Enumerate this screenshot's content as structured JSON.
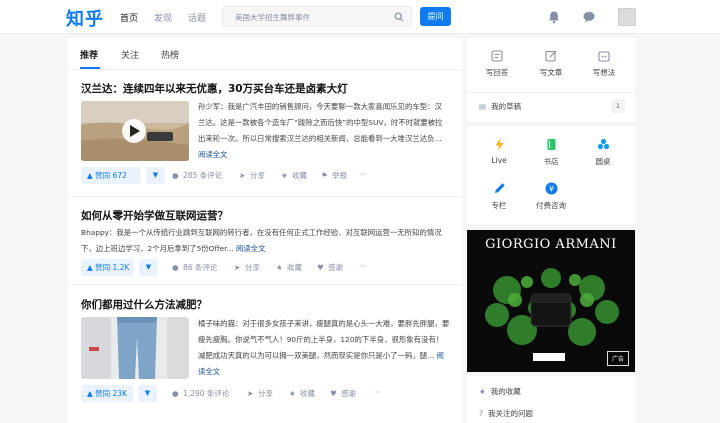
{
  "header": {
    "logo": "知乎",
    "nav": [
      "首页",
      "发现",
      "话题"
    ],
    "search_placeholder": "美国大学招生舞弊事件",
    "ask_button": "提问"
  },
  "feed": {
    "tabs": [
      "推荐",
      "关注",
      "热榜"
    ],
    "cards": [
      {
        "title": "汉兰达：连续四年以来无优惠，30万买台车还是卤素大灯",
        "excerpt": "孙少军：我是广汽丰田的销售顾问，今天要聊一款大家喜闻乐见的车型：汉兰达。这是一款被各个造车厂“跋除之而后快”的中型SUV，时不时就要被拉出来轮一次。所以日常搜索汉兰达的相关新闻，总能看到一大堆汉兰达负...",
        "read_more": "阅读全文",
        "vote": "赞同 672",
        "comments": "285 条评论",
        "share": "分享",
        "favorite": "收藏",
        "extra": "举报",
        "more": "···"
      },
      {
        "title": "如何从零开始学做互联网运营？",
        "excerpt": "Bhappy：我是一个从传统行业跳到互联网的转行者，在没有任何正式工作经验、对互联网运营一无所知的情况下，边上班边学习，2个月后拿到了5份Offer...",
        "read_more": "阅读全文",
        "vote": "赞同 1.2K",
        "comments": "86 条评论",
        "share": "分享",
        "favorite": "收藏",
        "extra": "感谢",
        "more": "···"
      },
      {
        "title": "你们都用过什么方法减肥？",
        "excerpt": "橘子味的猫：对于很多女孩子来讲，瘦腿真的是心头一大难，要胖先胖腿，要瘦先瘦胸。你说气不气人！90斤的上半身，120的下半身，很形象有没有！减肥成功天真的以为可以拥一双美腿，然而现实是你只是小了一码，腿...",
        "read_more": "阅读全文",
        "vote": "赞同 23K",
        "comments": "1,290 条评论",
        "share": "分享",
        "favorite": "收藏",
        "extra": "感谢",
        "more": "···"
      }
    ]
  },
  "sidebar": {
    "write": [
      "写回答",
      "写文章",
      "写想法"
    ],
    "drafts": "我的草稿",
    "drafts_count": "1",
    "features": [
      "Live",
      "书店",
      "圆桌",
      "专栏",
      "付费咨询"
    ],
    "ad": {
      "brand": "GIORGIO ARMANI",
      "label": "广告"
    },
    "links": [
      "我的收藏",
      "我关注的问题"
    ]
  },
  "colors": {
    "brand": "#0e7cf0",
    "live": "#f5b316",
    "bookstore": "#2ac36b",
    "roundtable": "#0e9cf0",
    "column": "#0e7cf0",
    "consult": "#0e7cf0"
  }
}
